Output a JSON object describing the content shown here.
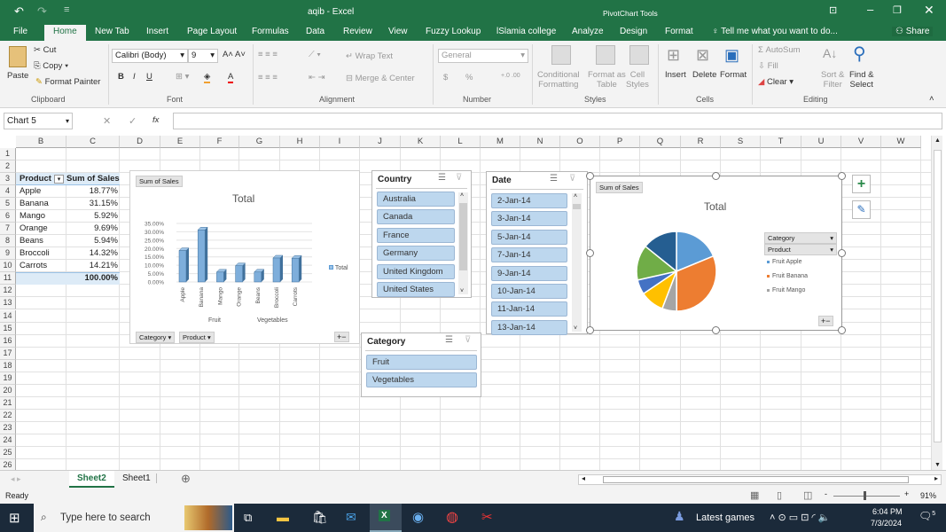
{
  "window": {
    "title": "aqib - Excel",
    "context_title": "PivotChart Tools"
  },
  "tabs": [
    "File",
    "Home",
    "New Tab",
    "Insert",
    "Page Layout",
    "Formulas",
    "Data",
    "Review",
    "View",
    "Fuzzy Lookup",
    "lSlamia college",
    "Analyze",
    "Design",
    "Format"
  ],
  "tell_me": "Tell me what you want to do...",
  "share": "Share",
  "ribbon": {
    "clipboard": {
      "paste": "Paste",
      "cut": "Cut",
      "copy": "Copy",
      "format_painter": "Format Painter",
      "label": "Clipboard"
    },
    "font": {
      "name": "Calibri (Body)",
      "size": "9",
      "bold": "B",
      "italic": "I",
      "underline": "U",
      "label": "Font"
    },
    "alignment": {
      "wrap": "Wrap Text",
      "merge": "Merge & Center",
      "label": "Alignment"
    },
    "number": {
      "format": "General",
      "currency": "$",
      "percent": "%",
      "label": "Number"
    },
    "styles": {
      "conditional": "Conditional",
      "conditional2": "Formatting",
      "format_table": "Format as",
      "format_table2": "Table",
      "cell_styles": "Cell",
      "cell_styles2": "Styles",
      "label": "Styles"
    },
    "cells": {
      "insert": "Insert",
      "delete": "Delete",
      "format": "Format",
      "label": "Cells"
    },
    "editing": {
      "autosum": "AutoSum",
      "fill": "Fill",
      "clear": "Clear",
      "sort": "Sort &",
      "sort2": "Filter",
      "find": "Find &",
      "find2": "Select",
      "label": "Editing"
    }
  },
  "formula_bar": {
    "name_box": "Chart 5",
    "fx": "fx",
    "value": ""
  },
  "columns": [
    "B",
    "C",
    "D",
    "E",
    "F",
    "G",
    "H",
    "I",
    "J",
    "K",
    "L",
    "M",
    "N",
    "O",
    "P",
    "Q",
    "R",
    "S",
    "T",
    "U",
    "V",
    "W"
  ],
  "rows": [
    "1",
    "2",
    "3",
    "4",
    "5",
    "6",
    "7",
    "8",
    "9",
    "10",
    "11",
    "12",
    "13",
    "14",
    "15",
    "16",
    "17",
    "18",
    "19",
    "20",
    "21",
    "22",
    "23",
    "24",
    "25",
    "26"
  ],
  "pivot": {
    "headers": [
      "Product",
      "Sum of Sales"
    ],
    "rows": [
      [
        "Apple",
        "18.77%"
      ],
      [
        "Banana",
        "31.15%"
      ],
      [
        "Mango",
        "5.92%"
      ],
      [
        "Orange",
        "9.69%"
      ],
      [
        "Beans",
        "5.94%"
      ],
      [
        "Broccoli",
        "14.32%"
      ],
      [
        "Carrots",
        "14.21%"
      ]
    ],
    "total": "100.00%"
  },
  "slicers": {
    "country": {
      "title": "Country",
      "items": [
        "Australia",
        "Canada",
        "France",
        "Germany",
        "United Kingdom",
        "United States"
      ]
    },
    "date": {
      "title": "Date",
      "items": [
        "2-Jan-14",
        "3-Jan-14",
        "5-Jan-14",
        "7-Jan-14",
        "9-Jan-14",
        "10-Jan-14",
        "11-Jan-14",
        "13-Jan-14"
      ]
    },
    "category": {
      "title": "Category",
      "items": [
        "Fruit",
        "Vegetables"
      ]
    }
  },
  "chart_data": [
    {
      "type": "bar",
      "title": "Total",
      "value_button": "Sum of Sales",
      "categories": [
        "Apple",
        "Banana",
        "Mango",
        "Orange",
        "Beans",
        "Broccoli",
        "Carrots"
      ],
      "groups": [
        {
          "name": "Fruit",
          "count": 4
        },
        {
          "name": "Vegetables",
          "count": 3
        }
      ],
      "series": [
        {
          "name": "Total",
          "values": [
            18.77,
            31.15,
            5.92,
            9.69,
            5.94,
            14.32,
            14.21
          ],
          "color": "#5b9bd5"
        }
      ],
      "yticks": [
        "0.00%",
        "5.00%",
        "10.00%",
        "15.00%",
        "20.00%",
        "25.00%",
        "30.00%",
        "35.00%"
      ],
      "ylim": [
        0,
        35
      ],
      "grid": true,
      "legend": "right",
      "field_buttons": [
        "Category",
        "Product"
      ]
    },
    {
      "type": "pie",
      "title": "Total",
      "value_button": "Sum of Sales",
      "categories": [
        "Apple",
        "Banana",
        "Mango",
        "Orange",
        "Beans",
        "Broccoli",
        "Carrots"
      ],
      "values": [
        18.77,
        31.15,
        5.92,
        9.69,
        5.94,
        14.32,
        14.21
      ],
      "colors": [
        "#5b9bd5",
        "#ed7d31",
        "#a5a5a5",
        "#ffc000",
        "#4472c4",
        "#70ad47",
        "#255e91"
      ],
      "legend_fields": [
        "Category",
        "Product"
      ],
      "legend_items": [
        "Fruit Apple",
        "Fruit Banana",
        "Fruit Mango"
      ],
      "legend": "right"
    }
  ],
  "sheet_tabs": [
    "Sheet2",
    "Sheet1"
  ],
  "status": {
    "ready": "Ready",
    "zoom": "91%"
  },
  "taskbar": {
    "search": "Type here to search",
    "news": "Latest games",
    "time": "6:04 PM",
    "date": "7/3/2024",
    "notifications": "5"
  }
}
